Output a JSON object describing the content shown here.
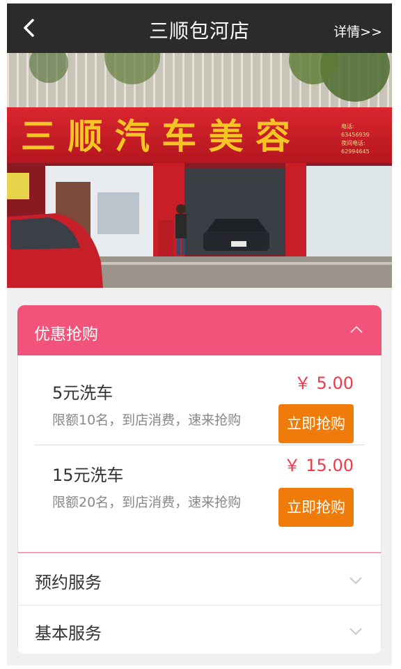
{
  "header": {
    "title": "三顺包河店",
    "details_link": "详情>>",
    "back_icon": "chevron-left-icon"
  },
  "storefront": {
    "sign_text": "三 顺 汽 车 美 容",
    "phone_lines": [
      "电话:",
      "63456939",
      "夜间电话:",
      "62994645"
    ]
  },
  "promotions": {
    "section_title": "优惠抢购",
    "collapse_icon": "chevron-up-icon",
    "accent_color": "#f2537a",
    "items": [
      {
        "name": "5元洗车",
        "desc": "限额10名，到店消费，速来抢购",
        "price": "￥ 5.00",
        "button": "立即抢购"
      },
      {
        "name": "15元洗车",
        "desc": "限额20名，到店消费，速来抢购",
        "price": "￥ 15.00",
        "button": "立即抢购"
      }
    ]
  },
  "booking": {
    "section_title": "预约服务",
    "expand_icon": "chevron-down-icon"
  },
  "basic": {
    "section_title": "基本服务",
    "expand_icon": "chevron-down-icon"
  },
  "colors": {
    "header_bg": "#2b2b2b",
    "price": "#f2394a",
    "buy_button": "#ef7b0b"
  }
}
